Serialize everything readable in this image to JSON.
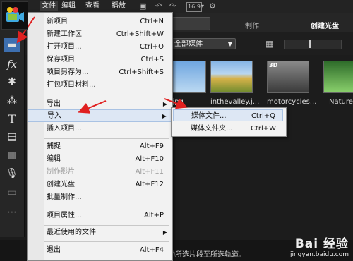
{
  "menubar": {
    "items": [
      "文件",
      "编辑",
      "查看",
      "播放"
    ],
    "aspect": "16:9"
  },
  "tabs": [
    "制作",
    "创建光盘"
  ],
  "library": {
    "filter": "全部媒体",
    "thumbnails": [
      {
        "label": "sky.jpg"
      },
      {
        "label": "inthevalley.j..."
      },
      {
        "label": "motorcycles..."
      },
      {
        "label": "Nature.."
      }
    ]
  },
  "file_menu": {
    "items": [
      {
        "label": "新项目",
        "shortcut": "Ctrl+N"
      },
      {
        "label": "新建工作区",
        "shortcut": "Ctrl+Shift+W"
      },
      {
        "label": "打开项目...",
        "shortcut": "Ctrl+O"
      },
      {
        "label": "保存项目",
        "shortcut": "Ctrl+S"
      },
      {
        "label": "项目另存为...",
        "shortcut": "Ctrl+Shift+S"
      },
      {
        "label": "打包项目材料...",
        "shortcut": ""
      },
      {
        "label": "导出",
        "shortcut": ""
      },
      {
        "label": "导入",
        "shortcut": ""
      },
      {
        "label": "插入项目...",
        "shortcut": ""
      },
      {
        "label": "捕捉",
        "shortcut": "Alt+F9"
      },
      {
        "label": "编辑",
        "shortcut": "Alt+F10"
      },
      {
        "label": "制作影片",
        "shortcut": "Alt+F11"
      },
      {
        "label": "创建光盘",
        "shortcut": "Alt+F12"
      },
      {
        "label": "批量制作...",
        "shortcut": ""
      },
      {
        "label": "项目属性...",
        "shortcut": "Alt+P"
      },
      {
        "label": "最近使用的文件",
        "shortcut": ""
      },
      {
        "label": "退出",
        "shortcut": "Alt+F4"
      }
    ]
  },
  "import_submenu": {
    "items": [
      {
        "label": "媒体文件...",
        "shortcut": "Ctrl+Q"
      },
      {
        "label": "媒体文件夹...",
        "shortcut": "Ctrl+W"
      }
    ]
  },
  "status": {
    "text": "动所选片段至所选轨道。"
  },
  "watermark": {
    "logo": "Bai 经验",
    "url": "jingyan.baidu.com"
  },
  "colors": {
    "arrow": "#e02020",
    "highlight": "#dde7f4"
  }
}
